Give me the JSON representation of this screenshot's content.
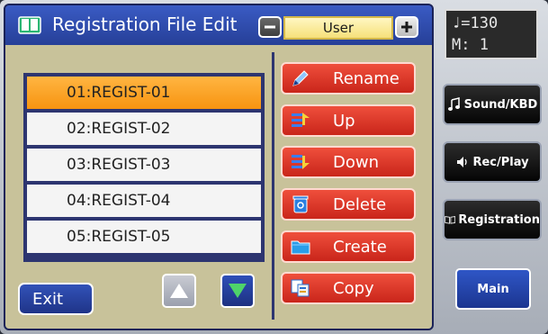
{
  "header": {
    "title": "Registration File Edit",
    "mode_value": "User"
  },
  "file_list": {
    "items": [
      {
        "label": "01:REGIST-01",
        "selected": true
      },
      {
        "label": "02:REGIST-02",
        "selected": false
      },
      {
        "label": "03:REGIST-03",
        "selected": false
      },
      {
        "label": "04:REGIST-04",
        "selected": false
      },
      {
        "label": "05:REGIST-05",
        "selected": false
      }
    ]
  },
  "actions": {
    "rename": "Rename",
    "up": "Up",
    "down": "Down",
    "delete": "Delete",
    "create": "Create",
    "copy": "Copy"
  },
  "footer": {
    "exit_label": "Exit"
  },
  "lcd": {
    "tempo": "♩=130",
    "measure": "M:   1"
  },
  "side": {
    "sound_kbd": "Sound/KBD",
    "rec_play": "Rec/Play",
    "registration": "Registration",
    "main": "Main"
  },
  "icons": {
    "title": "book-icon",
    "rename": "pencil-icon",
    "up": "move-up-icon",
    "down": "move-down-icon",
    "delete": "trash-icon",
    "create": "folder-icon",
    "copy": "copy-icon"
  },
  "colors": {
    "selected_row": "#f79410",
    "action_button": "#d8321f",
    "screen_blue": "#2a3f8c",
    "panel_tan": "#c8c29a"
  }
}
